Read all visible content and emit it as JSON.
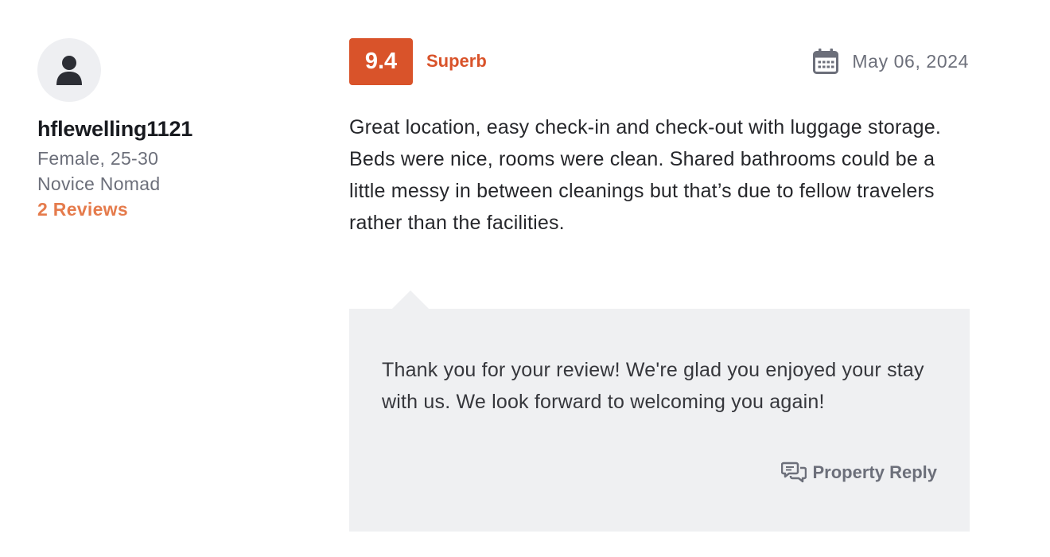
{
  "reviewer": {
    "icon": "user-icon",
    "name": "hflewelling1121",
    "demographic": "Female, 25-30",
    "level": "Novice Nomad",
    "reviews_link": "2 Reviews"
  },
  "rating": {
    "score": "9.4",
    "label": "Superb",
    "badge_color": "#d9532a"
  },
  "date": {
    "icon": "calendar-icon",
    "text": "May 06, 2024"
  },
  "review": {
    "text": "Great location, easy check-in and check-out with luggage storage. Beds were nice, rooms were clean. Shared bathrooms could be a little messy in between cleanings but that’s due to fellow travelers rather than the facilities."
  },
  "reply": {
    "text": "Thank you for your review! We're glad you enjoyed your stay with us. We look forward to welcoming you again!",
    "icon": "chat-bubbles-icon",
    "label": "Property Reply",
    "background": "#eff0f2"
  },
  "colors": {
    "accent": "#d9532a",
    "link": "#e57b4c",
    "muted": "#6c6f7a"
  }
}
